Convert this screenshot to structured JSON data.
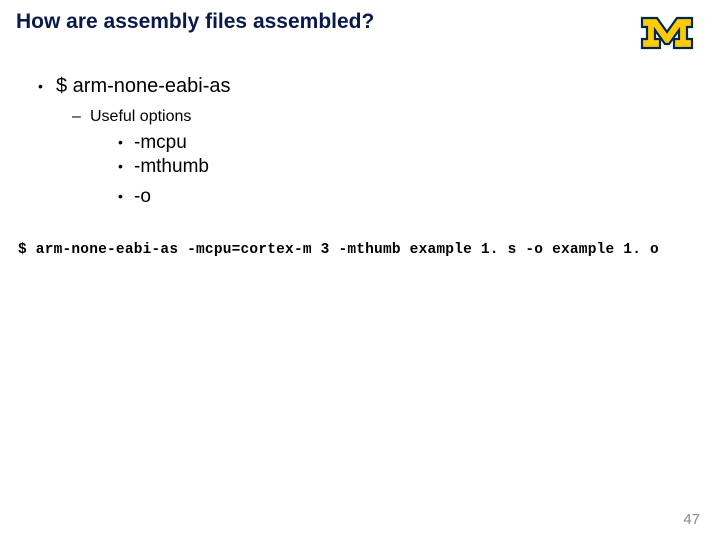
{
  "title": "How are assembly files assembled?",
  "logo": {
    "letter": "M",
    "color_maize": "#ffcb05",
    "color_blue": "#00274c"
  },
  "bullets": {
    "l1": "$ arm-none-eabi-as",
    "l2": "Useful options",
    "l3a": "-mcpu",
    "l3b": "-mthumb",
    "l3c": "-o"
  },
  "command": "$ arm-none-eabi-as -mcpu=cortex-m 3 -mthumb example 1. s -o example 1. o",
  "page_number": "47"
}
